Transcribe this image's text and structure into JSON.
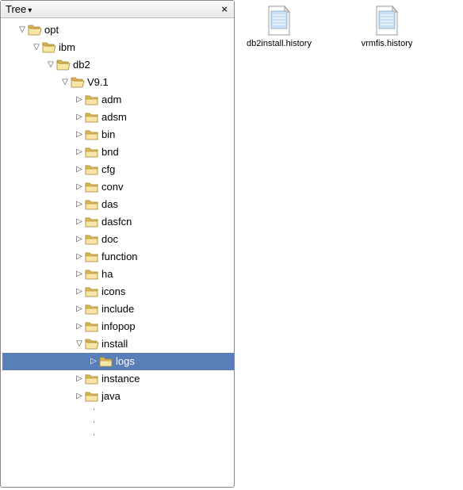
{
  "panel": {
    "title": "Tree",
    "close_glyph": "×"
  },
  "tree": {
    "nodes": [
      {
        "id": "opt",
        "label": "opt",
        "depth": 0,
        "twisty": "down",
        "open": true,
        "selected": false
      },
      {
        "id": "ibm",
        "label": "ibm",
        "depth": 1,
        "twisty": "down",
        "open": true,
        "selected": false
      },
      {
        "id": "db2",
        "label": "db2",
        "depth": 2,
        "twisty": "down",
        "open": true,
        "selected": false
      },
      {
        "id": "v91",
        "label": "V9.1",
        "depth": 3,
        "twisty": "down",
        "open": true,
        "selected": false
      },
      {
        "id": "adm",
        "label": "adm",
        "depth": 4,
        "twisty": "right",
        "open": false,
        "selected": false
      },
      {
        "id": "adsm",
        "label": "adsm",
        "depth": 4,
        "twisty": "right",
        "open": false,
        "selected": false
      },
      {
        "id": "bin",
        "label": "bin",
        "depth": 4,
        "twisty": "right",
        "open": false,
        "selected": false
      },
      {
        "id": "bnd",
        "label": "bnd",
        "depth": 4,
        "twisty": "right",
        "open": false,
        "selected": false
      },
      {
        "id": "cfg",
        "label": "cfg",
        "depth": 4,
        "twisty": "right",
        "open": false,
        "selected": false
      },
      {
        "id": "conv",
        "label": "conv",
        "depth": 4,
        "twisty": "right",
        "open": false,
        "selected": false
      },
      {
        "id": "das",
        "label": "das",
        "depth": 4,
        "twisty": "right",
        "open": false,
        "selected": false
      },
      {
        "id": "dasfcn",
        "label": "dasfcn",
        "depth": 4,
        "twisty": "right",
        "open": false,
        "selected": false
      },
      {
        "id": "doc",
        "label": "doc",
        "depth": 4,
        "twisty": "right",
        "open": false,
        "selected": false
      },
      {
        "id": "function",
        "label": "function",
        "depth": 4,
        "twisty": "right",
        "open": false,
        "selected": false
      },
      {
        "id": "ha",
        "label": "ha",
        "depth": 4,
        "twisty": "right",
        "open": false,
        "selected": false
      },
      {
        "id": "icons",
        "label": "icons",
        "depth": 4,
        "twisty": "right",
        "open": false,
        "selected": false
      },
      {
        "id": "include",
        "label": "include",
        "depth": 4,
        "twisty": "right",
        "open": false,
        "selected": false
      },
      {
        "id": "infopop",
        "label": "infopop",
        "depth": 4,
        "twisty": "right",
        "open": false,
        "selected": false
      },
      {
        "id": "install",
        "label": "install",
        "depth": 4,
        "twisty": "down",
        "open": true,
        "selected": false
      },
      {
        "id": "logs",
        "label": "logs",
        "depth": 5,
        "twisty": "right",
        "open": false,
        "selected": true
      },
      {
        "id": "instance",
        "label": "instance",
        "depth": 4,
        "twisty": "right",
        "open": false,
        "selected": false
      },
      {
        "id": "java",
        "label": "java",
        "depth": 4,
        "twisty": "right",
        "open": false,
        "selected": false
      }
    ],
    "dots_indent_depth": 5
  },
  "files": [
    {
      "name": "db2install.history"
    },
    {
      "name": "vrmfis.history"
    }
  ],
  "glyphs": {
    "twisty_right": "▷",
    "twisty_down": "▽"
  },
  "colors": {
    "selection": "#5a7fb8",
    "folder_light": "#f6e6a8",
    "folder_dark": "#d9b856",
    "folder_stroke": "#a8822c",
    "file_fill": "#c9dff5",
    "file_stroke": "#6a8fb8"
  }
}
